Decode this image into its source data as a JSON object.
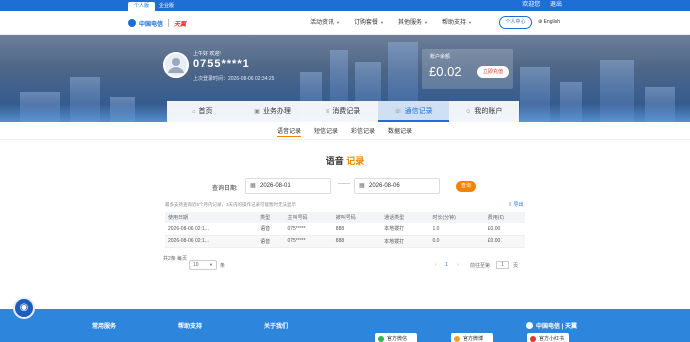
{
  "topbar": {
    "segments": [
      "个人版",
      "企业版"
    ],
    "links": [
      "欢迎您",
      "退出"
    ]
  },
  "header": {
    "logo_cn": "中国电信",
    "logo_brand": "天翼",
    "nav": [
      "活动资讯",
      "订购套餐",
      "其他服务",
      "帮助支持"
    ],
    "user_center": "个人中心",
    "lang": "English"
  },
  "banner": {
    "greeting_small": "上午好 欢迎!",
    "username": "0755****1",
    "last_login": "上次登录时间：2026-08-06 02:34:25",
    "account": {
      "label": "账户余额",
      "amount": "£0.02",
      "recharge": "立即充值"
    }
  },
  "tabs": [
    {
      "label": "首页",
      "icon": "home-icon",
      "glyph": "⌂"
    },
    {
      "label": "业务办理",
      "icon": "briefcase-icon",
      "glyph": "▣"
    },
    {
      "label": "消费记录",
      "icon": "receipt-icon",
      "glyph": "≡"
    },
    {
      "label": "通信记录",
      "icon": "phone-icon",
      "glyph": "☏"
    },
    {
      "label": "我的账户",
      "icon": "user-icon",
      "glyph": "☺"
    }
  ],
  "subtabs": [
    "语音记录",
    "短信记录",
    "彩信记录",
    "数据记录"
  ],
  "page_title": {
    "a": "语音",
    "b": "记录"
  },
  "query": {
    "label": "查询日期:",
    "start": "2026-08-01",
    "end": "2026-08-06",
    "dash": "——",
    "button": "查询",
    "hint": "最多支持查询近6个月内记录，3天内的操作记录可能暂时无法显示",
    "export": "导出"
  },
  "table": {
    "headers": [
      "使用日期",
      "类型",
      "主叫号码",
      "被叫号码",
      "通话类型",
      "时长(分钟)",
      "费用(€)"
    ],
    "rows": [
      [
        "2026-08-06 02:1...",
        "语音",
        "075*****",
        "888",
        "本地拨打",
        "1.0",
        "£0.00"
      ],
      [
        "2026-08-06 02:1...",
        "语音",
        "075*****",
        "888",
        "本地拨打",
        "0.0",
        "£0.00"
      ]
    ]
  },
  "pager": {
    "total": "共2条",
    "per_page_label": "每页",
    "per_page": "10",
    "unit": "条",
    "prev": "‹",
    "current": "1",
    "next": "›",
    "goto_label": "前往至第",
    "goto_value": "1",
    "page_unit": "页"
  },
  "footer": {
    "cols": [
      "常用服务",
      "帮助支持",
      "关于我们"
    ],
    "cards": [
      "官方微信",
      "官方微博",
      "官方小红书"
    ],
    "logo": "中国电信 | 天翼"
  },
  "colors": {
    "primary": "#1f6ed6",
    "accent": "#f08300",
    "footer": "#2e86dc"
  }
}
